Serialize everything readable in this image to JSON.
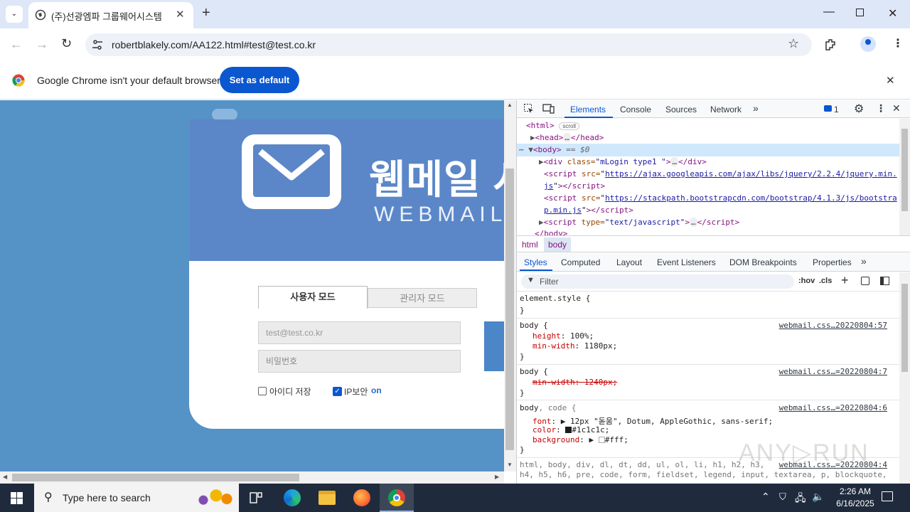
{
  "browser": {
    "tab_title": "(주)선광엠파 그룹웨어시스템",
    "url": "robertblakely.com/AA122.html#test@test.co.kr",
    "infobar_text": "Google Chrome isn't your default browser",
    "set_default_label": "Set as default"
  },
  "page": {
    "logo_title": "웹메일 시",
    "logo_sub": "WEBMAIL S",
    "tab_user": "사용자 모드",
    "tab_admin": "관리자 모드",
    "email_value": "test@test.co.kr",
    "password_placeholder": "비밀번호",
    "save_id_label": "아이디 저장",
    "ip_label": "IP보안",
    "ip_state": "on"
  },
  "devtools": {
    "tabs": [
      "Elements",
      "Console",
      "Sources",
      "Network"
    ],
    "issues_count": "1",
    "dom": {
      "html_open": "<html>",
      "scroll_badge": "scroll",
      "head": "<head>",
      "head_close": "</head>",
      "body": "<body>",
      "body_eq": "== $0",
      "div_open": "<div ",
      "div_attr": "class=",
      "div_val": "\"mLogin type1 \"",
      "div_close": "</div>",
      "script1_src": "https://ajax.googleapis.com/ajax/libs/jquery/2.2.4/jquery.min.",
      "script1_tail": "js",
      "script2_src": "https://stackpath.bootstrapcdn.com/bootstrap/4.1.3/js/bootstra",
      "script2_tail": "p.min.js",
      "script3_type": "\"text/javascript\"",
      "body_close": "</body>"
    },
    "breadcrumbs": [
      "html",
      "body"
    ],
    "styles_tabs": [
      "Styles",
      "Computed",
      "Layout",
      "Event Listeners",
      "DOM Breakpoints",
      "Properties"
    ],
    "filter_placeholder": "Filter",
    "hov": ":hov",
    "cls": ".cls",
    "rules": {
      "element_style": "element.style {",
      "r1_sel": "body {",
      "r1_src": "webmail.css…20220804:57",
      "r1_p1": "height",
      "r1_v1": "100%;",
      "r1_p2": "min-width",
      "r1_v2": "1180px;",
      "r2_sel": "body {",
      "r2_src": "webmail.css…=20220804:7",
      "r2_p1": "min-width: 1240px;",
      "r3_sel_a": "body",
      "r3_sel_b": ", code {",
      "r3_src": "webmail.css…=20220804:6",
      "r3_p1": "font",
      "r3_v1": "12px \"돋움\", Dotum, AppleGothic, sans-serif;",
      "r3_p2": "color",
      "r3_v2": "#1c1c1c;",
      "r3_p3": "background",
      "r3_v3": "#fff;",
      "r4_sel": "html, body, div, dl, dt, dd, ul, ol, li, h1, h2, h3,",
      "r4_sel2": "h4, h5, h6, pre, code, form, fieldset, legend, input, textarea, p, blockquote,",
      "r4_src": "webmail.css…=20220804:4",
      "close_brace": "}"
    }
  },
  "taskbar": {
    "search_placeholder": "Type here to search",
    "time": "2:26 AM",
    "date": "6/16/2025"
  },
  "colors": {
    "chrome_blue": "#0b57d0",
    "page_bg": "#5592c6",
    "card_header": "#5b87c9",
    "taskbar": "#1f2b3d"
  }
}
